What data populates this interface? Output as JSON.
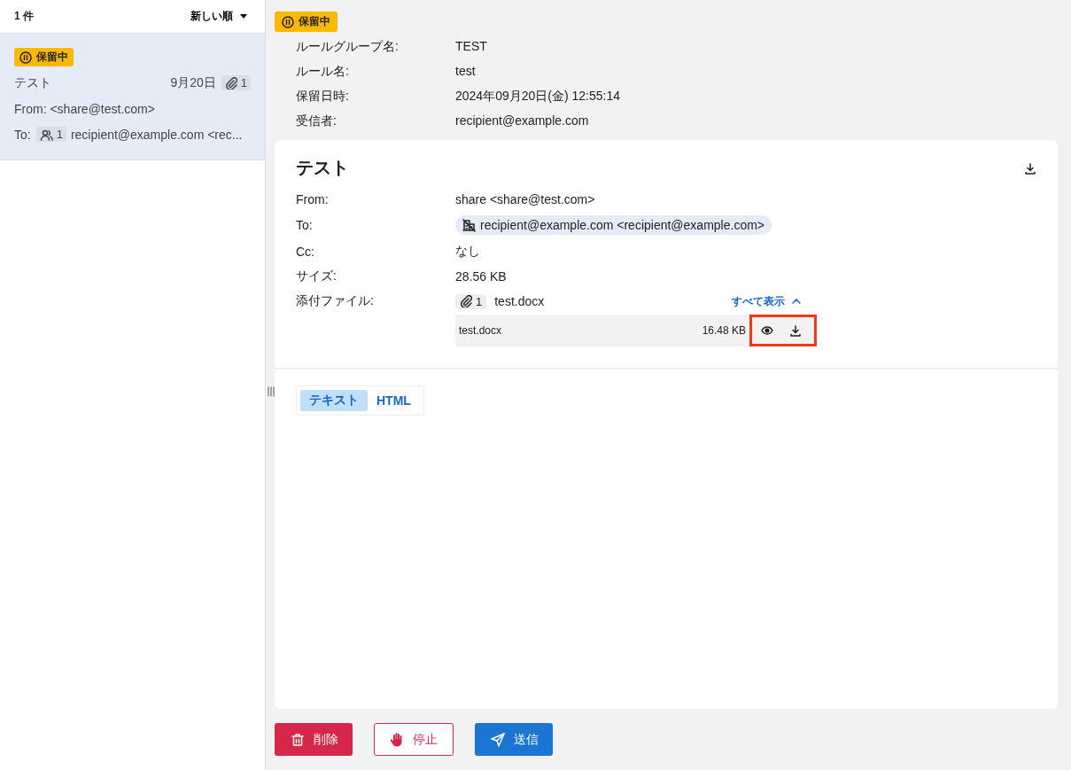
{
  "list_header": {
    "count": "1 件",
    "sort": "新しい順"
  },
  "messages": [
    {
      "status": "保留中",
      "subject": "テスト",
      "date": "9月20日",
      "attachment_count": "1",
      "from": "From: <share@test.com>",
      "to_label": "To:",
      "recipient_count": "1",
      "to": "recipient@example.com <rec...",
      "selected": true
    }
  ],
  "detail": {
    "status": "保留中",
    "meta": [
      {
        "label": "ルールグループ名:",
        "value": "TEST"
      },
      {
        "label": "ルール名:",
        "value": "test"
      },
      {
        "label": "保留日時:",
        "value": "2024年09月20日(金) 12:55:14"
      },
      {
        "label": "受信者:",
        "value": "recipient@example.com"
      }
    ]
  },
  "mail": {
    "subject": "テスト",
    "fields": [
      {
        "label": "From:",
        "value": "share <share@test.com>",
        "kind": "text"
      },
      {
        "label": "To:",
        "value": "recipient@example.com <recipient@example.com>",
        "kind": "chip"
      },
      {
        "label": "Cc:",
        "value": "なし",
        "kind": "text"
      },
      {
        "label": "サイズ:",
        "value": "28.56 KB",
        "kind": "text"
      }
    ],
    "attachments": {
      "label": "添付ファイル:",
      "count": "1",
      "summary": "test.docx",
      "toggle": "すべて表示",
      "expanded": true,
      "files": [
        {
          "name": "test.docx",
          "size": "16.48 KB",
          "highlighted": true
        }
      ]
    }
  },
  "body_tabs": [
    {
      "label": "テキスト",
      "selected": true
    },
    {
      "label": "HTML",
      "selected": false
    }
  ],
  "buttons": [
    {
      "label": "削除",
      "kind": "delete"
    },
    {
      "label": "停止",
      "kind": "stop"
    },
    {
      "label": "送信",
      "kind": "send"
    }
  ]
}
